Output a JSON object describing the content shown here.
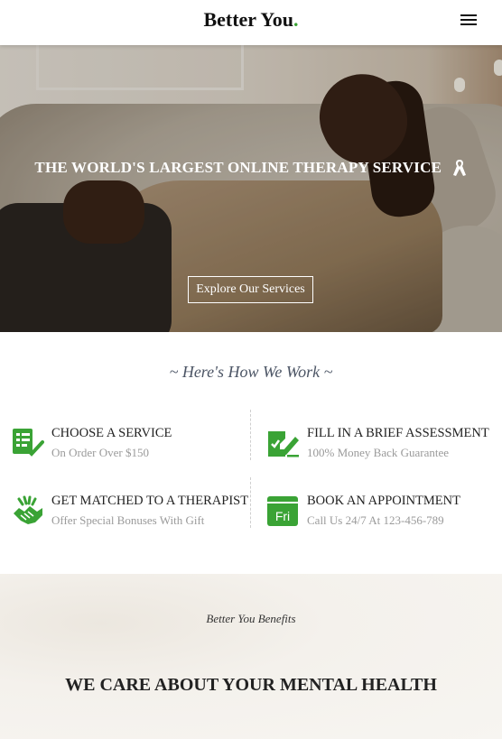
{
  "header": {
    "logo_text": "Better You",
    "logo_dot": ".",
    "menu_icon": "hamburger-menu-icon"
  },
  "hero": {
    "title": "THE WORLD'S LARGEST ONLINE THERAPY SERVICE",
    "title_icon": "awareness-ribbon-icon",
    "button_label": "Explore Our Services"
  },
  "how": {
    "heading": "~ Here's How We Work ~",
    "steps": [
      {
        "title": "CHOOSE A SERVICE",
        "subtitle": "On Order Over $150",
        "icon": "checklist-icon"
      },
      {
        "title": "FILL IN A BRIEF ASSESSMENT",
        "subtitle": "100% Money Back Guarantee",
        "icon": "assessment-icon"
      },
      {
        "title": "GET MATCHED TO A THERAPIST",
        "subtitle": "Offer Special Bonuses With Gift",
        "icon": "handshake-icon"
      },
      {
        "title": "BOOK AN APPOINTMENT",
        "subtitle": "Call Us 24/7 At 123-456-789",
        "icon": "calendar-icon",
        "icon_text": "Fri"
      }
    ]
  },
  "benefits": {
    "label": "Better You Benefits",
    "title": "WE CARE ABOUT YOUR MENTAL HEALTH"
  },
  "colors": {
    "accent": "#3aa335",
    "text": "#222222",
    "muted": "#9a9a9a",
    "heading_italic": "#4c5565"
  }
}
